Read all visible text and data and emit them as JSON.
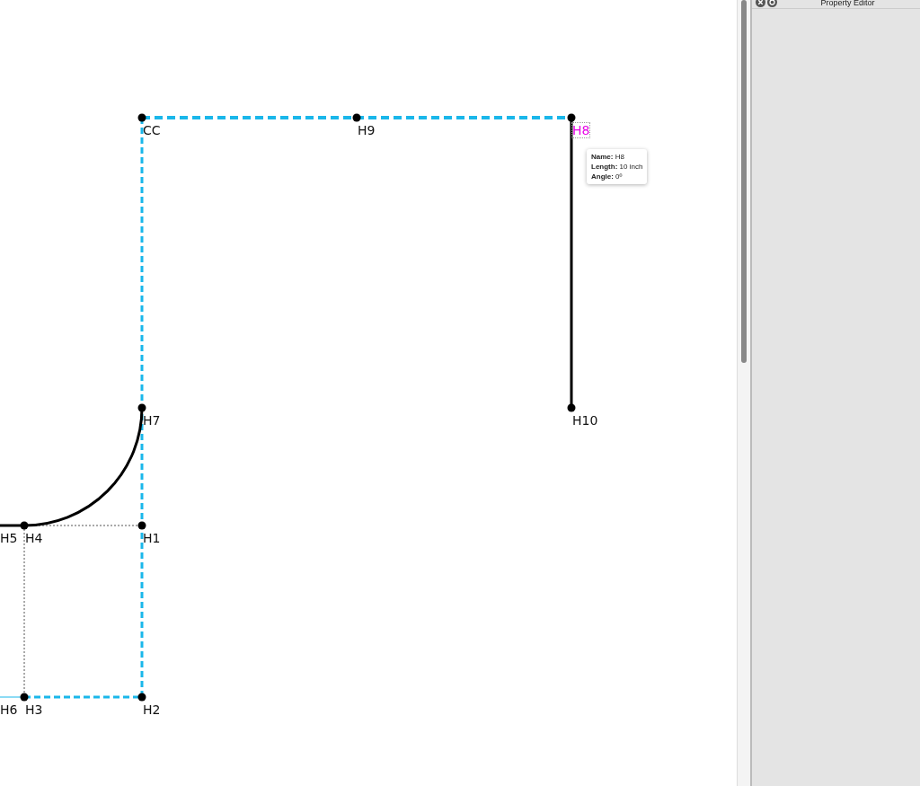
{
  "canvas": {
    "points": [
      {
        "label": "CC",
        "selected": false
      },
      {
        "label": "H9",
        "selected": false
      },
      {
        "label": "H8",
        "selected": true
      },
      {
        "label": "H10",
        "selected": false
      },
      {
        "label": "H7",
        "selected": false
      },
      {
        "label": "H5",
        "selected": false
      },
      {
        "label": "H4",
        "selected": false
      },
      {
        "label": "H1",
        "selected": false
      },
      {
        "label": "H6",
        "selected": false
      },
      {
        "label": "H3",
        "selected": false
      },
      {
        "label": "H2",
        "selected": false
      }
    ],
    "tooltip": [
      {
        "label": "Name:",
        "value": "H8"
      },
      {
        "label": "Length:",
        "value": "10 inch"
      },
      {
        "label": "Angle:",
        "value": "0º"
      }
    ]
  },
  "property_editor": {
    "title": "Property Editor"
  }
}
